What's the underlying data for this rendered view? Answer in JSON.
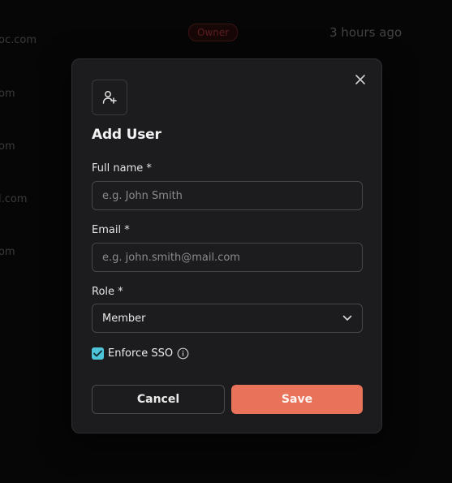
{
  "background": {
    "emails": [
      "oc.com",
      "om",
      "om",
      "l.com",
      "om"
    ],
    "role_badge": "Owner",
    "last_active": "3 hours ago"
  },
  "modal": {
    "title": "Add User",
    "header_icon": "user-plus-icon",
    "close_icon": "close-icon",
    "fields": {
      "full_name": {
        "label": "Full name *",
        "placeholder": "e.g. John Smith",
        "value": ""
      },
      "email": {
        "label": "Email *",
        "placeholder": "e.g. john.smith@mail.com",
        "value": ""
      },
      "role": {
        "label": "Role *",
        "selected": "Member"
      }
    },
    "enforce_sso": {
      "label": "Enforce SSO",
      "checked": true,
      "info_icon": "info-icon"
    },
    "buttons": {
      "cancel": "Cancel",
      "save": "Save"
    }
  },
  "colors": {
    "accent": "#e8735a",
    "checkbox": "#4ec4d8",
    "modal_bg": "#1c1c1e",
    "page_bg": "#060606"
  }
}
